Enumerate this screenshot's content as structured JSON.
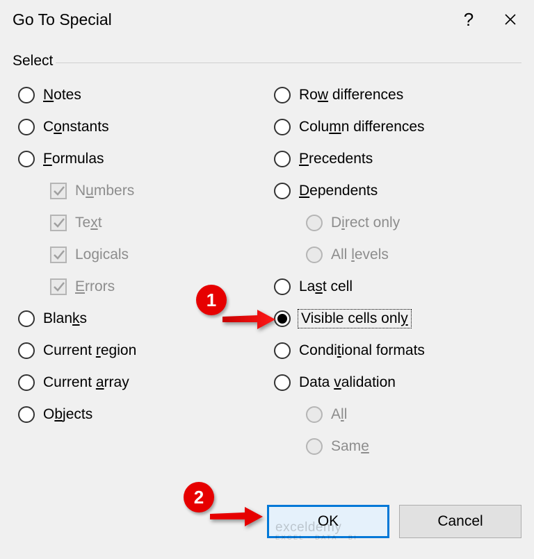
{
  "title": "Go To Special",
  "group_label": "Select",
  "left": {
    "notes": "Notes",
    "constants": "Constants",
    "formulas": "Formulas",
    "numbers": "Numbers",
    "text": "Text",
    "logicals": "Logicals",
    "errors": "Errors",
    "blanks": "Blanks",
    "current_region": "Current region",
    "current_array": "Current array",
    "objects": "Objects"
  },
  "right": {
    "row_diff": "Row differences",
    "col_diff": "Column differences",
    "precedents": "Precedents",
    "dependents": "Dependents",
    "direct_only": "Direct only",
    "all_levels": "All levels",
    "last_cell": "Last cell",
    "visible": "Visible cells only",
    "cond_formats": "Conditional formats",
    "data_validation": "Data validation",
    "all": "All",
    "same": "Same"
  },
  "buttons": {
    "ok": "OK",
    "cancel": "Cancel"
  },
  "annotations": {
    "n1": "1",
    "n2": "2"
  },
  "selected": "visible",
  "watermark": "exceldemy",
  "watermark_sub": "EXCEL · DATA · BI"
}
